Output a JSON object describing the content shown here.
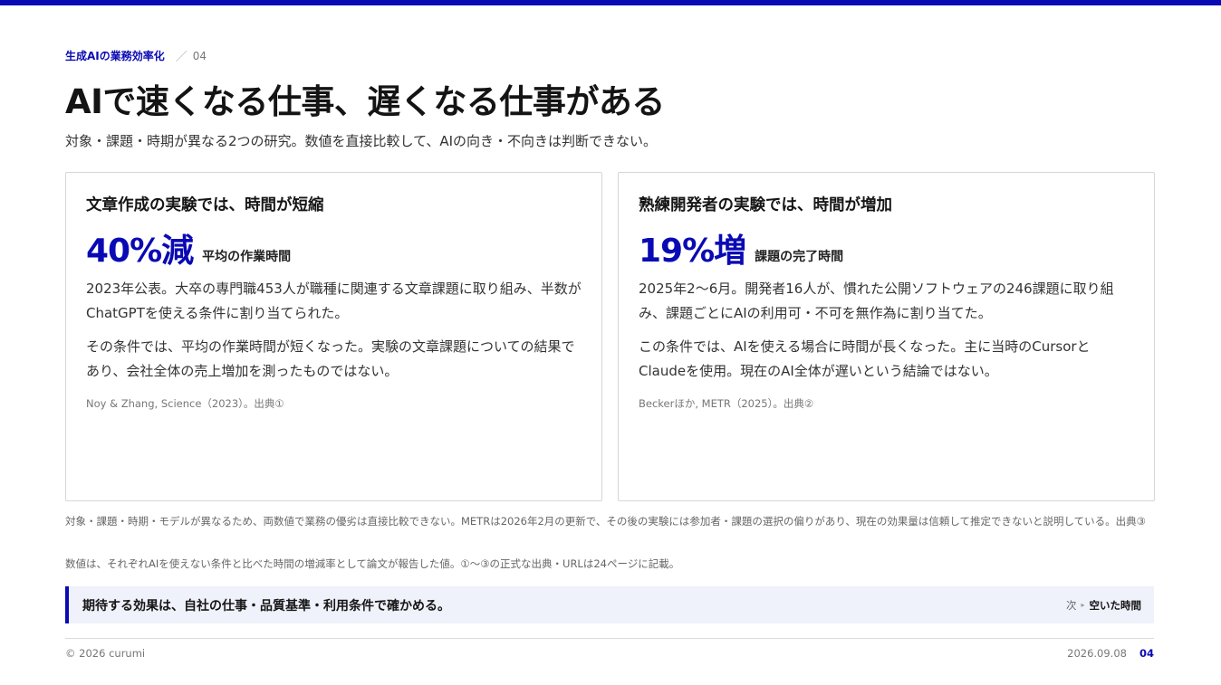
{
  "header": {
    "section": "生成AIの業務効率化",
    "slash": "／",
    "page_number": "04",
    "title": "AIで速くなる仕事、遅くなる仕事がある",
    "subtitle": "対象・課題・時期が異なる2つの研究。数値を直接比較して、AIの向き・不向きは判断できない。"
  },
  "cards": [
    {
      "heading": "文章作成の実験では、時間が短縮",
      "metric": "40%減",
      "metric_label": "平均の作業時間",
      "paragraphs": [
        "2023年公表。大卒の専門職453人が職種に関連する文章課題に取り組み、半数がChatGPTを使える条件に割り当てられた。",
        "その条件では、平均の作業時間が短くなった。実験の文章課題についての結果であり、会社全体の売上増加を測ったものではない。"
      ],
      "source": "Noy & Zhang, Science（2023）。出典①"
    },
    {
      "heading": "熟練開発者の実験では、時間が増加",
      "metric": "19%増",
      "metric_label": "課題の完了時間",
      "paragraphs": [
        "2025年2〜6月。開発者16人が、慣れた公開ソフトウェアの246課題に取り組み、課題ごとにAIの利用可・不可を無作為に割り当てた。",
        "この条件では、AIを使える場合に時間が長くなった。主に当時のCursorとClaudeを使用。現在のAI全体が遅いという結論ではない。"
      ],
      "source": "Beckerほか, METR（2025）。出典②"
    }
  ],
  "notes": {
    "note1": "対象・課題・時期・モデルが異なるため、両数値で業務の優劣は直接比較できない。METRは2026年2月の更新で、その後の実験には参加者・課題の選択の偏りがあり、現在の効果量は信頼して推定できないと説明している。出典③",
    "note2": "数値は、それぞれAIを使えない条件と比べた時間の増減率として論文が報告した値。①〜③の正式な出典・URLは24ページに記載。"
  },
  "callout": {
    "text": "期待する効果は、自社の仕事・品質基準・利用条件で確かめる。",
    "next_label": "次",
    "next_arrow": "▸",
    "next_title": "空いた時間"
  },
  "footer": {
    "copyright": "© 2026 curumi",
    "date": "2026.09.08",
    "page": "04"
  },
  "colors": {
    "accent": "#0a0ab4",
    "callout_bg": "#eff1fb"
  }
}
